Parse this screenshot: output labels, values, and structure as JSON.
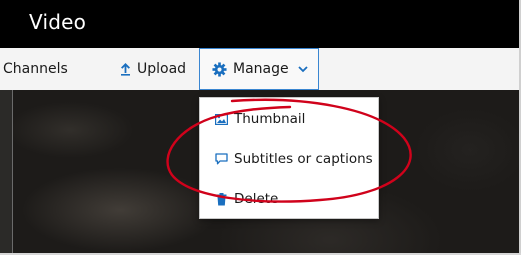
{
  "header": {
    "title": "Video"
  },
  "toolbar": {
    "channels_label": "Channels",
    "upload_label": "Upload",
    "manage_label": "Manage"
  },
  "manage_menu": {
    "items": [
      {
        "label": "Thumbnail",
        "icon": "image-icon"
      },
      {
        "label": "Subtitles or captions",
        "icon": "speech-bubble-icon"
      },
      {
        "label": "Delete",
        "icon": "trash-icon"
      }
    ]
  },
  "colors": {
    "header_bg": "#000000",
    "accent": "#1a6fbf",
    "annotation": "#d0021b"
  }
}
